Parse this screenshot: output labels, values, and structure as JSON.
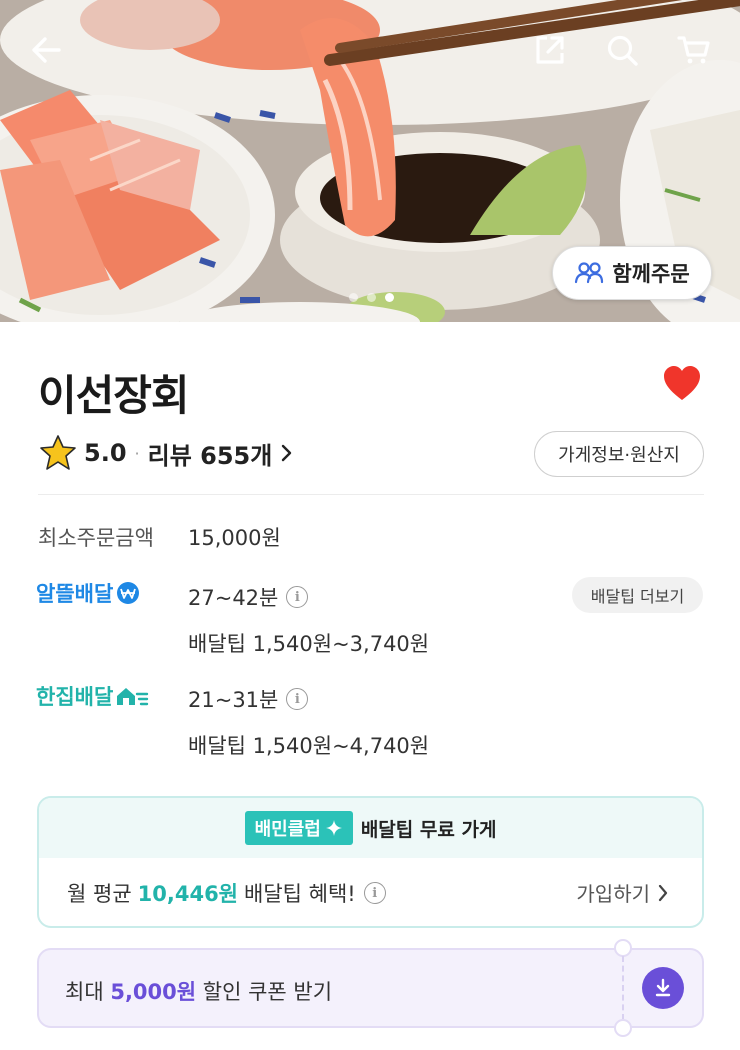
{
  "store": {
    "name": "이선장회",
    "rating": "5.0",
    "review_text": "리뷰 655개",
    "info_button": "가게정보·원산지"
  },
  "hero": {
    "together_order": "함께주문",
    "slide_count": 3,
    "active_slide": 3
  },
  "min_order": {
    "label": "최소주문금액",
    "value": "15,000원"
  },
  "delivery": [
    {
      "brand": "알뜰배달",
      "brand_color": "#1e88e5",
      "time": "27~42분",
      "tip": "배달팁 1,540원~3,740원"
    },
    {
      "brand": "한집배달",
      "brand_color": "#22b3aa",
      "time": "21~31분",
      "tip": "배달팁 1,540원~4,740원"
    }
  ],
  "more_tip_button": "배달팁 더보기",
  "club": {
    "badge": "배민클럽",
    "title": "배달팁 무료 가게",
    "prefix": "월 평균",
    "amount": "10,446원",
    "suffix": "배달팁 혜택!",
    "join": "가입하기"
  },
  "coupon": {
    "prefix": "최대",
    "amount": "5,000원",
    "suffix": "할인 쿠폰 받기"
  },
  "colors": {
    "heart": "#f0352b",
    "club_accent": "#22b3aa",
    "coupon_accent": "#6a4fd8",
    "star": "#f6c31c"
  }
}
